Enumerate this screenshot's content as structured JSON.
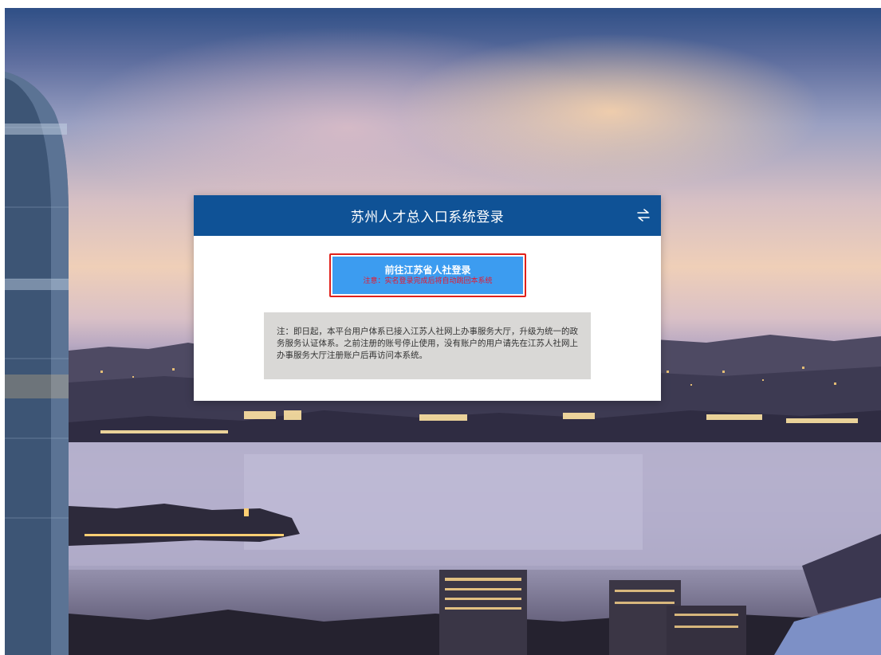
{
  "login_panel": {
    "title": "苏州人才总入口系统登录",
    "switch_icon": "switch-arrows-icon",
    "login_button": {
      "label": "前往江苏省人社登录",
      "sub_label": "注意：实名登录完成后将自动跳回本系统"
    },
    "notice": {
      "text": "注：即日起，本平台用户体系已接入江苏人社网上办事服务大厅，升级为统一的政务服务认证体系。之前注册的账号停止使用，没有账户的用户请先在江苏人社网上办事服务大厅注册账户后再访问本系统。"
    }
  },
  "colors": {
    "header": "#0f5296",
    "button": "#3c9cf0",
    "button_border": "#e0201a",
    "sub_label": "#e8172c",
    "notice_bg": "#d9d8d6"
  }
}
